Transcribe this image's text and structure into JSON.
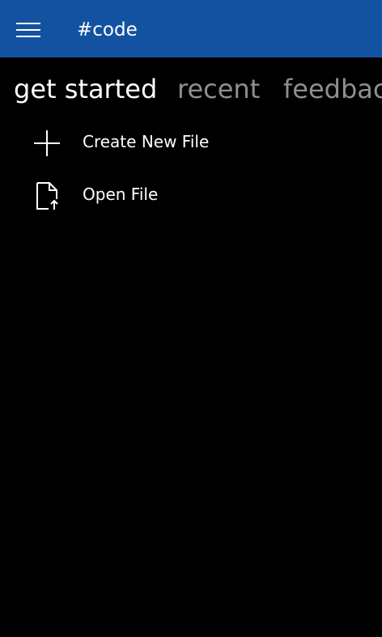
{
  "colors": {
    "titlebar_background": "#1352a1",
    "page_background": "#000000",
    "text_primary": "#ffffff",
    "text_inactive": "#8f8f8f"
  },
  "titlebar": {
    "menu_icon": "hamburger-icon",
    "title": "#code"
  },
  "pivot": {
    "tabs": [
      {
        "label": "get started",
        "active": true
      },
      {
        "label": "recent",
        "active": false
      },
      {
        "label": "feedbac",
        "active": false
      }
    ]
  },
  "actions": [
    {
      "label": "Create New File",
      "icon": "plus-icon"
    },
    {
      "label": "Open File",
      "icon": "open-file-icon"
    }
  ]
}
